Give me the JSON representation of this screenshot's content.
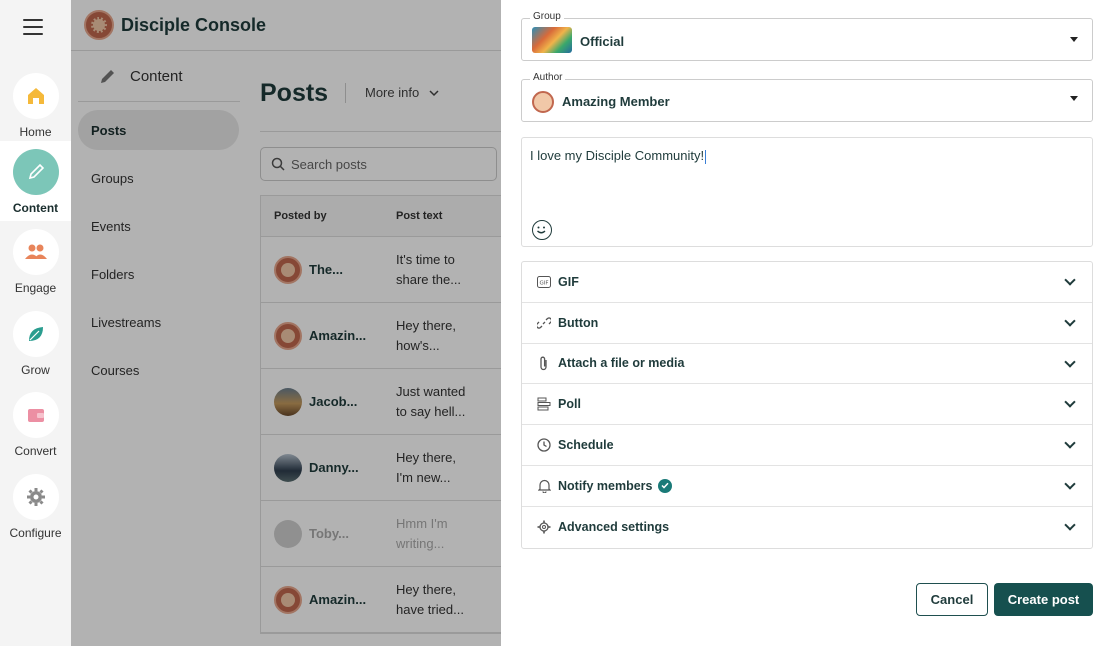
{
  "nav": {
    "items": [
      {
        "label": "Home",
        "icon": "home-icon"
      },
      {
        "label": "Content",
        "icon": "pencil-icon",
        "active": true
      },
      {
        "label": "Engage",
        "icon": "people-icon"
      },
      {
        "label": "Grow",
        "icon": "leaf-icon"
      },
      {
        "label": "Convert",
        "icon": "wallet-icon"
      },
      {
        "label": "Configure",
        "icon": "gear-icon"
      }
    ]
  },
  "header": {
    "title": "Disciple Console"
  },
  "subnav": {
    "title": "Content",
    "items": [
      "Posts",
      "Groups",
      "Events",
      "Folders",
      "Livestreams",
      "Courses"
    ]
  },
  "main": {
    "title": "Posts",
    "more_info": "More info",
    "search_placeholder": "Search posts",
    "columns": [
      "Posted by",
      "Post text"
    ],
    "rows": [
      {
        "author": "The...",
        "text1": "It's time to",
        "text2": "share the..."
      },
      {
        "author": "Amazin...",
        "text1": "Hey there,",
        "text2": "how's..."
      },
      {
        "author": "Jacob...",
        "text1": "Just wanted",
        "text2": "to say hell..."
      },
      {
        "author": "Danny...",
        "text1": "Hey there,",
        "text2": "I'm new..."
      },
      {
        "author": "Toby...",
        "text1": "Hmm I'm",
        "text2": "writing..."
      },
      {
        "author": "Amazin...",
        "text1": "Hey there,",
        "text2": "have tried..."
      }
    ]
  },
  "panel": {
    "group_label": "Group",
    "group_value": "Official",
    "author_label": "Author",
    "author_value": "Amazing Member",
    "post_text": "I love my Disciple Community!",
    "sections": [
      "GIF",
      "Button",
      "Attach a file or media",
      "Poll",
      "Schedule",
      "Notify members",
      "Advanced settings"
    ],
    "cancel_label": "Cancel",
    "create_label": "Create post"
  },
  "colors": {
    "accent": "#16504f",
    "active_nav": "#7cc6b8",
    "check": "#1a7a78"
  }
}
